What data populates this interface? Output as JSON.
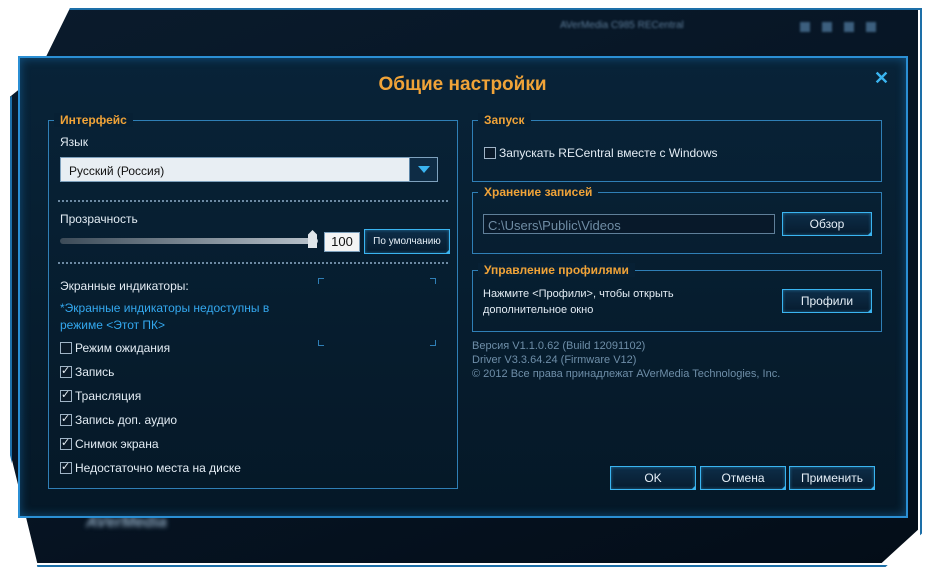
{
  "background": {
    "app_title": "AVerMedia C985 RECentral",
    "logo_text": "AVerMedia"
  },
  "dialog": {
    "title": "Общие настройки",
    "close_icon": "close-icon"
  },
  "interface": {
    "legend": "Интерфейс",
    "language_label": "Язык",
    "language_value": "Русский (Россия)",
    "transparency_label": "Прозрачность",
    "transparency_value": "100",
    "transparency_level": 1.0,
    "default_button": "По умолчанию",
    "indicators_label": "Экранные индикаторы:",
    "indicators_hint": "*Экранные индикаторы недоступны в режиме <Этот ПК>",
    "indicators_hint_line1": "*Экранные индикаторы недоступны в",
    "indicators_hint_line2": "режиме <Этот ПК>",
    "checkboxes": [
      {
        "label": "Режим ожидания",
        "checked": false
      },
      {
        "label": "Запись",
        "checked": true
      },
      {
        "label": "Трансляция",
        "checked": true
      },
      {
        "label": "Запись доп. аудио",
        "checked": true
      },
      {
        "label": "Снимок экрана",
        "checked": true
      },
      {
        "label": "Недостаточно места на диске",
        "checked": true
      }
    ]
  },
  "startup": {
    "legend": "Запуск",
    "autostart_label": "Запускать RECentral вместе с Windows",
    "autostart_checked": false
  },
  "storage": {
    "legend": "Хранение записей",
    "path": "C:\\Users\\Public\\Videos",
    "browse_button": "Обзор"
  },
  "profiles": {
    "legend": "Управление профилями",
    "description_line1": "Нажмите <Профили>, чтобы открыть",
    "description_line2": "дополнительное окно",
    "profiles_button": "Профили"
  },
  "about": {
    "version": "Версия V1.1.0.62 (Build 12091102)",
    "driver": "Driver V3.3.64.24 (Firmware V12)",
    "copyright": "© 2012 Все права принадлежат AVerMedia Technologies, Inc."
  },
  "footer": {
    "ok": "OK",
    "cancel": "Отмена",
    "apply": "Применить"
  },
  "colors": {
    "accent": "#2b8fd4",
    "title_orange": "#f0a338",
    "hint_blue": "#33a8ef"
  }
}
